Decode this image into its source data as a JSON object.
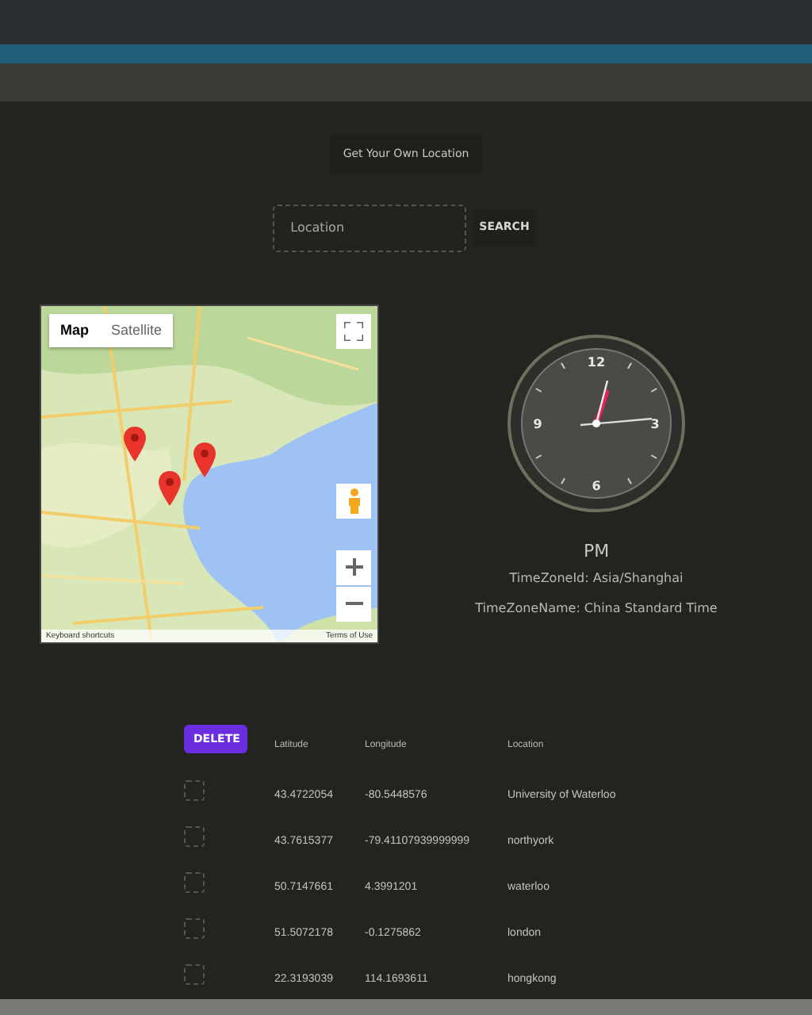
{
  "own_location_button": "Get Your Own Location",
  "search": {
    "placeholder": "Location",
    "button": "SEARCH"
  },
  "map": {
    "kind": "picture",
    "map_types": [
      {
        "label": "Map",
        "selected": true
      },
      {
        "label": "Satellite",
        "selected": false
      }
    ],
    "footer": [
      "Keyboard shortcuts",
      "Terms of Use"
    ]
  },
  "clock": {
    "numerals": [
      "12",
      "3",
      "6",
      "9"
    ],
    "period": "PM",
    "timezone_id": "TimeZoneId: Asia/Shanghai",
    "timezone_name": "TimeZoneName: China Standard Time"
  },
  "table": {
    "delete_button": "DELETE",
    "columns": [
      "Latitude",
      "Longitude",
      "Location"
    ],
    "rows": [
      {
        "selected": false,
        "cells": [
          "43.4722054",
          "-80.5448576",
          "University of Waterloo"
        ]
      },
      {
        "selected": false,
        "cells": [
          "43.7615377",
          "-79.41107939999999",
          "northyork"
        ]
      },
      {
        "selected": false,
        "cells": [
          "50.7147661",
          "4.3991201",
          "waterloo"
        ]
      },
      {
        "selected": false,
        "cells": [
          "51.5072178",
          "-0.1275862",
          "london"
        ]
      },
      {
        "selected": false,
        "cells": [
          "22.3193039",
          "114.1693611",
          "hongkong"
        ]
      }
    ]
  }
}
